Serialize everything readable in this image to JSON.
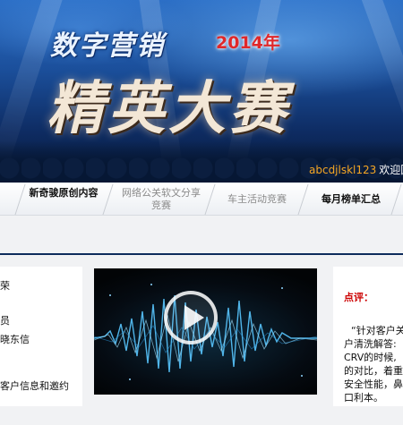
{
  "banner": {
    "headline_top": "数字营销",
    "headline_year": "2014年",
    "headline_main": "精英大赛",
    "user_name": "abcdjlskl123",
    "welcome": "欢迎回"
  },
  "nav": {
    "tabs": [
      {
        "label": "新奇骏原创内容",
        "active": false
      },
      {
        "label": "网络公关软文分享竞赛",
        "active": false
      },
      {
        "label": "车主活动竞赛",
        "active": false
      },
      {
        "label": "每月榜单汇总",
        "active": false
      }
    ]
  },
  "left_card": {
    "lines": [
      "荣",
      "员",
      "晓东信",
      "客户信息和邀约"
    ]
  },
  "video": {
    "label": "video player"
  },
  "right_card": {
    "title": "点评：",
    "lines": [
      "“针对客户关",
      "户清洗解答:",
      "CRV的时候,",
      "的对比，着重",
      "安全性能，鼻",
      "口利本。"
    ]
  },
  "colors": {
    "nav_rule": "#0e2c5c",
    "review_title": "#cc0000",
    "user_name": "#f5a623"
  }
}
